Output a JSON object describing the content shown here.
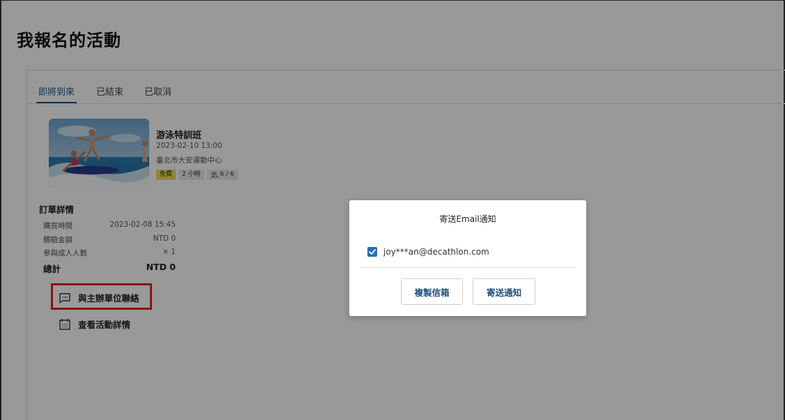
{
  "page": {
    "title": "我報名的活動"
  },
  "tabs": [
    {
      "label": "即將到來",
      "active": true
    },
    {
      "label": "已結束",
      "active": false
    },
    {
      "label": "已取消",
      "active": false
    }
  ],
  "event": {
    "title": "游泳特訓班",
    "datetime": "2023-02-10 13:00",
    "location": "臺北市大安運動中心",
    "tags": {
      "price": "免費",
      "duration": "2 小時",
      "participants": "6 / 6"
    },
    "image_icon": "swimming-photo"
  },
  "order": {
    "title": "訂單詳情",
    "rows": [
      {
        "label": "購買時間",
        "value": "2023-02-08 15:45"
      },
      {
        "label": "體驗金額",
        "value": "NTD 0"
      },
      {
        "label": "參與成人人數",
        "value": "× 1"
      }
    ],
    "total_label": "總計",
    "total_value": "NTD 0"
  },
  "actions": {
    "contact_label": "與主辦單位聯絡",
    "contact_icon": "chat-icon",
    "details_label": "查看活動詳情",
    "details_icon": "calendar-icon"
  },
  "modal": {
    "title": "寄送Email通知",
    "email": "joy***an@decathlon.com",
    "email_checked": true,
    "copy_button": "複製信箱",
    "send_button": "寄送通知"
  },
  "colors": {
    "accent": "#1d5a8c",
    "highlight": "#e32222",
    "tag_free": "#f4e04d",
    "checkbox": "#2a6db8"
  }
}
